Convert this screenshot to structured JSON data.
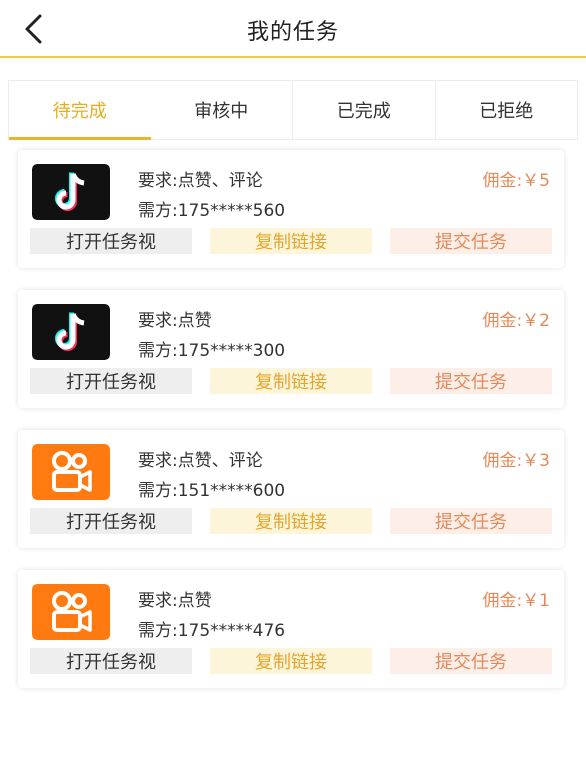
{
  "header": {
    "title": "我的任务"
  },
  "tabs": [
    {
      "label": "待完成",
      "active": true
    },
    {
      "label": "审核中",
      "active": false
    },
    {
      "label": "已完成",
      "active": false
    },
    {
      "label": "已拒绝",
      "active": false
    }
  ],
  "colors": {
    "accent": "#e9ad1c",
    "commission": "#e48a5a",
    "douyin_bg": "#111111",
    "kuaishou_bg": "#ff7a10"
  },
  "tasks": [
    {
      "app": "douyin-icon",
      "requirement": "要求:点赞、评论",
      "client": "需方:175*****560",
      "commission": "佣金:￥5",
      "open_label": "打开任务视",
      "copy_label": "复制链接",
      "submit_label": "提交任务"
    },
    {
      "app": "douyin-icon",
      "requirement": "要求:点赞",
      "client": "需方:175*****300",
      "commission": "佣金:￥2",
      "open_label": "打开任务视",
      "copy_label": "复制链接",
      "submit_label": "提交任务"
    },
    {
      "app": "kuaishou-icon",
      "requirement": "要求:点赞、评论",
      "client": "需方:151*****600",
      "commission": "佣金:￥3",
      "open_label": "打开任务视",
      "copy_label": "复制链接",
      "submit_label": "提交任务"
    },
    {
      "app": "kuaishou-icon",
      "requirement": "要求:点赞",
      "client": "需方:175*****476",
      "commission": "佣金:￥1",
      "open_label": "打开任务视",
      "copy_label": "复制链接",
      "submit_label": "提交任务"
    }
  ]
}
